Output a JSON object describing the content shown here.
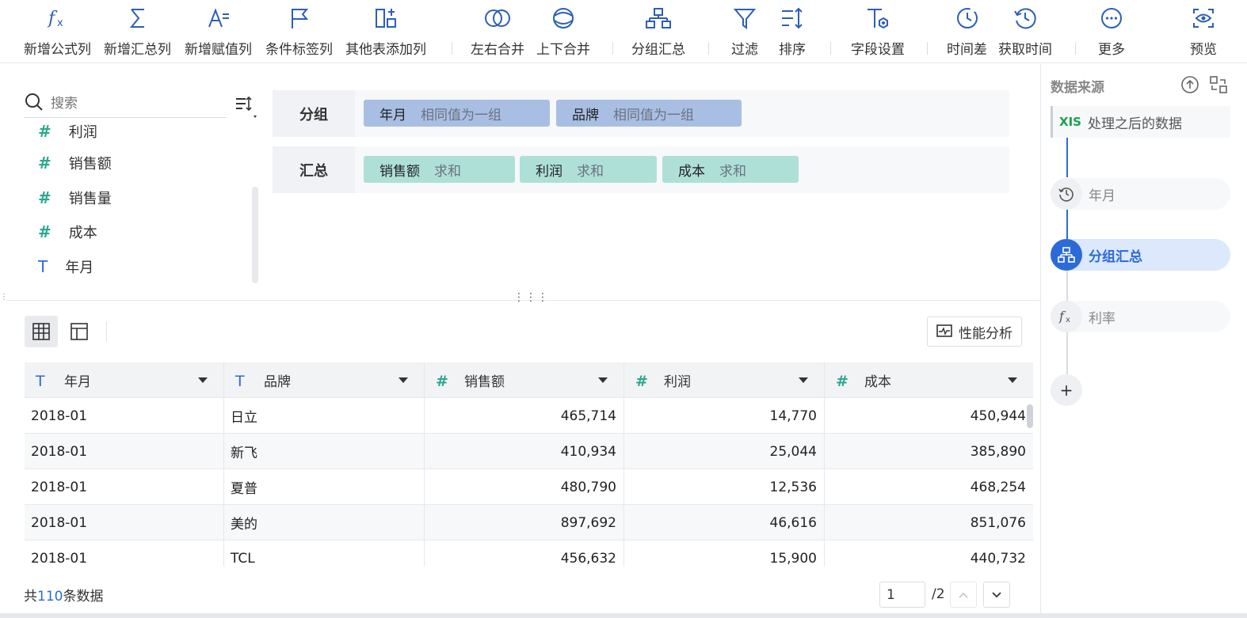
{
  "toolbar": {
    "items": [
      {
        "label": "新增公式列",
        "icon": "formula-icon"
      },
      {
        "label": "新增汇总列",
        "icon": "sigma-icon"
      },
      {
        "label": "新增赋值列",
        "icon": "assign-icon"
      },
      {
        "label": "条件标签列",
        "icon": "flag-icon"
      },
      {
        "label": "其他表添加列",
        "icon": "add-column-icon"
      },
      {
        "label": "左右合并",
        "icon": "merge-horizontal-icon"
      },
      {
        "label": "上下合并",
        "icon": "merge-vertical-icon"
      },
      {
        "label": "分组汇总",
        "icon": "group-summary-icon"
      },
      {
        "label": "过滤",
        "icon": "filter-icon"
      },
      {
        "label": "排序",
        "icon": "sort-icon"
      },
      {
        "label": "字段设置",
        "icon": "field-settings-icon"
      },
      {
        "label": "时间差",
        "icon": "time-diff-icon"
      },
      {
        "label": "获取时间",
        "icon": "get-time-icon"
      },
      {
        "label": "更多",
        "icon": "more-icon"
      },
      {
        "label": "预览",
        "icon": "preview-icon"
      }
    ]
  },
  "fields": {
    "search_placeholder": "搜索",
    "items": [
      {
        "name": "利润",
        "type": "number"
      },
      {
        "name": "销售额",
        "type": "number"
      },
      {
        "name": "销售量",
        "type": "number"
      },
      {
        "name": "成本",
        "type": "number"
      },
      {
        "name": "年月",
        "type": "text"
      }
    ]
  },
  "config": {
    "group_label": "分组",
    "group_chips": [
      {
        "name": "年月",
        "mode": "相同值为一组"
      },
      {
        "name": "品牌",
        "mode": "相同值为一组"
      }
    ],
    "summary_label": "汇总",
    "summary_chips": [
      {
        "name": "销售额",
        "mode": "求和"
      },
      {
        "name": "利润",
        "mode": "求和"
      },
      {
        "name": "成本",
        "mode": "求和"
      }
    ]
  },
  "preview": {
    "perf_label": "性能分析",
    "columns": [
      {
        "label": "年月",
        "type": "text"
      },
      {
        "label": "品牌",
        "type": "text"
      },
      {
        "label": "销售额",
        "type": "number"
      },
      {
        "label": "利润",
        "type": "number"
      },
      {
        "label": "成本",
        "type": "number"
      }
    ],
    "rows": [
      [
        "2018-01",
        "日立",
        "465,714",
        "14,770",
        "450,944"
      ],
      [
        "2018-01",
        "新飞",
        "410,934",
        "25,044",
        "385,890"
      ],
      [
        "2018-01",
        "夏普",
        "480,790",
        "12,536",
        "468,254"
      ],
      [
        "2018-01",
        "美的",
        "897,692",
        "46,616",
        "851,076"
      ],
      [
        "2018-01",
        "TCL",
        "456,632",
        "15,900",
        "440,732"
      ]
    ],
    "footer_prefix": "共",
    "footer_count": "110",
    "footer_suffix": "条数据",
    "page_current": "1",
    "page_total": "/2"
  },
  "sidebar": {
    "title": "数据来源",
    "source_badge": "XIS",
    "source_name": "处理之后的数据",
    "steps": [
      {
        "label": "年月",
        "icon": "clock-icon",
        "active": false
      },
      {
        "label": "分组汇总",
        "icon": "group-summary-icon",
        "active": true
      },
      {
        "label": "利率",
        "icon": "formula-icon",
        "active": false
      }
    ],
    "add_label": "+"
  },
  "colors": {
    "accent": "#2c6ad8",
    "group_chip": "#a8bfe3",
    "summary_chip": "#aee0d8",
    "number_type": "#2aa88f",
    "text_type": "#2c6ad8"
  }
}
